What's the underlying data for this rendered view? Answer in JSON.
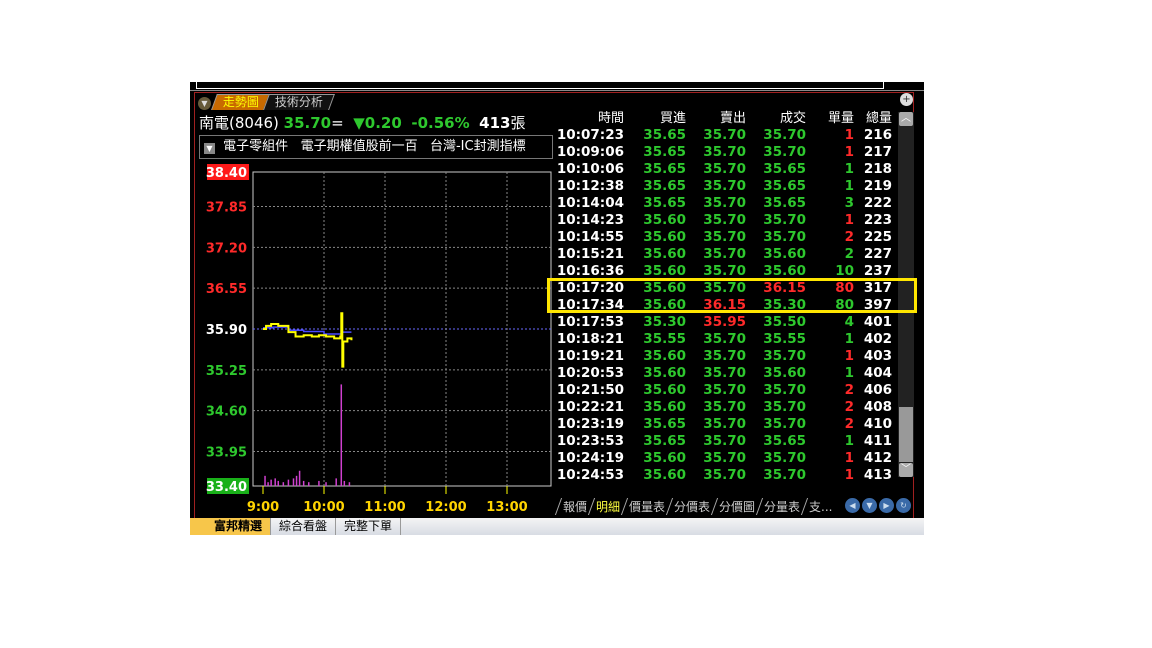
{
  "tabs": [
    "走勢圖",
    "技術分析"
  ],
  "quote": {
    "name": "南電(8046)",
    "price": "35.70",
    "flat_mark": "=",
    "change": "▼0.20",
    "pct": "-0.56%",
    "volume": "413",
    "volume_unit": "張"
  },
  "categories": [
    "電子零組件",
    "電子期權值股前一百",
    "台灣-IC封測指標"
  ],
  "table": {
    "headers": [
      "時間",
      "買進",
      "賣出",
      "成交",
      "單量",
      "總量"
    ],
    "rows": [
      [
        "10:07:23",
        "35.65",
        "35.70",
        "35.70",
        "1",
        "216",
        "g",
        "g",
        "g",
        "r"
      ],
      [
        "10:09:06",
        "35.65",
        "35.70",
        "35.70",
        "1",
        "217",
        "g",
        "g",
        "g",
        "r"
      ],
      [
        "10:10:06",
        "35.65",
        "35.70",
        "35.65",
        "1",
        "218",
        "g",
        "g",
        "g",
        "g"
      ],
      [
        "10:12:38",
        "35.65",
        "35.70",
        "35.65",
        "1",
        "219",
        "g",
        "g",
        "g",
        "g"
      ],
      [
        "10:14:04",
        "35.65",
        "35.70",
        "35.65",
        "3",
        "222",
        "g",
        "g",
        "g",
        "g"
      ],
      [
        "10:14:23",
        "35.60",
        "35.70",
        "35.70",
        "1",
        "223",
        "g",
        "g",
        "g",
        "r"
      ],
      [
        "10:14:55",
        "35.60",
        "35.70",
        "35.70",
        "2",
        "225",
        "g",
        "g",
        "g",
        "r"
      ],
      [
        "10:15:21",
        "35.60",
        "35.70",
        "35.60",
        "2",
        "227",
        "g",
        "g",
        "g",
        "g"
      ],
      [
        "10:16:36",
        "35.60",
        "35.70",
        "35.60",
        "10",
        "237",
        "g",
        "g",
        "g",
        "g"
      ],
      [
        "10:17:20",
        "35.60",
        "35.70",
        "36.15",
        "80",
        "317",
        "g",
        "g",
        "r",
        "r"
      ],
      [
        "10:17:34",
        "35.60",
        "36.15",
        "35.30",
        "80",
        "397",
        "g",
        "r",
        "g",
        "g"
      ],
      [
        "10:17:53",
        "35.30",
        "35.95",
        "35.50",
        "4",
        "401",
        "g",
        "r",
        "g",
        "g"
      ],
      [
        "10:18:21",
        "35.55",
        "35.70",
        "35.55",
        "1",
        "402",
        "g",
        "g",
        "g",
        "g"
      ],
      [
        "10:19:21",
        "35.60",
        "35.70",
        "35.70",
        "1",
        "403",
        "g",
        "g",
        "g",
        "r"
      ],
      [
        "10:20:53",
        "35.60",
        "35.70",
        "35.60",
        "1",
        "404",
        "g",
        "g",
        "g",
        "g"
      ],
      [
        "10:21:50",
        "35.60",
        "35.70",
        "35.70",
        "2",
        "406",
        "g",
        "g",
        "g",
        "r"
      ],
      [
        "10:22:21",
        "35.60",
        "35.70",
        "35.70",
        "2",
        "408",
        "g",
        "g",
        "g",
        "r"
      ],
      [
        "10:23:19",
        "35.65",
        "35.70",
        "35.70",
        "2",
        "410",
        "g",
        "g",
        "g",
        "r"
      ],
      [
        "10:23:53",
        "35.65",
        "35.70",
        "35.65",
        "1",
        "411",
        "g",
        "g",
        "g",
        "g"
      ],
      [
        "10:24:19",
        "35.60",
        "35.70",
        "35.70",
        "1",
        "412",
        "g",
        "g",
        "g",
        "r"
      ],
      [
        "10:24:53",
        "35.60",
        "35.70",
        "35.70",
        "1",
        "413",
        "g",
        "g",
        "g",
        "r"
      ]
    ]
  },
  "bottom_tabs": [
    "報價",
    "明細",
    "價量表",
    "分價表",
    "分價圖",
    "分量表",
    "支..."
  ],
  "footer_tabs": [
    "富邦精選",
    "綜合看盤",
    "完整下單"
  ],
  "colors": {
    "up": "#ff2a2a",
    "down": "#2ec82e",
    "price_line": "#ffff00",
    "avg_line": "#4a4aff",
    "volume": "#d040d0"
  },
  "chart_data": {
    "type": "line",
    "y_ticks": [
      "38.40",
      "37.85",
      "37.20",
      "36.55",
      "35.90",
      "35.25",
      "34.60",
      "33.95",
      "33.40"
    ],
    "ylim": [
      33.4,
      38.4
    ],
    "reference": 35.9,
    "x_ticks": [
      "9:00",
      "10:00",
      "11:00",
      "12:00",
      "13:00"
    ],
    "price": [
      [
        0,
        35.9
      ],
      [
        3,
        35.95
      ],
      [
        8,
        35.98
      ],
      [
        15,
        35.95
      ],
      [
        22,
        35.95
      ],
      [
        25,
        35.85
      ],
      [
        32,
        35.78
      ],
      [
        40,
        35.8
      ],
      [
        48,
        35.78
      ],
      [
        55,
        35.8
      ],
      [
        62,
        35.78
      ],
      [
        70,
        35.75
      ],
      [
        76,
        35.78
      ],
      [
        77,
        36.15
      ],
      [
        78,
        35.3
      ],
      [
        79,
        35.7
      ],
      [
        83,
        35.75
      ],
      [
        87,
        35.72
      ]
    ],
    "avg": [
      [
        0,
        35.92
      ],
      [
        10,
        35.93
      ],
      [
        25,
        35.88
      ],
      [
        40,
        35.86
      ],
      [
        60,
        35.82
      ],
      [
        77,
        35.85
      ],
      [
        87,
        35.85
      ]
    ],
    "volume": [
      [
        2,
        8
      ],
      [
        5,
        3
      ],
      [
        8,
        5
      ],
      [
        12,
        6
      ],
      [
        15,
        4
      ],
      [
        20,
        3
      ],
      [
        25,
        5
      ],
      [
        30,
        6
      ],
      [
        33,
        8
      ],
      [
        36,
        12
      ],
      [
        40,
        4
      ],
      [
        45,
        3
      ],
      [
        55,
        4
      ],
      [
        62,
        3
      ],
      [
        72,
        6
      ],
      [
        77,
        80
      ],
      [
        80,
        4
      ],
      [
        85,
        3
      ]
    ]
  }
}
